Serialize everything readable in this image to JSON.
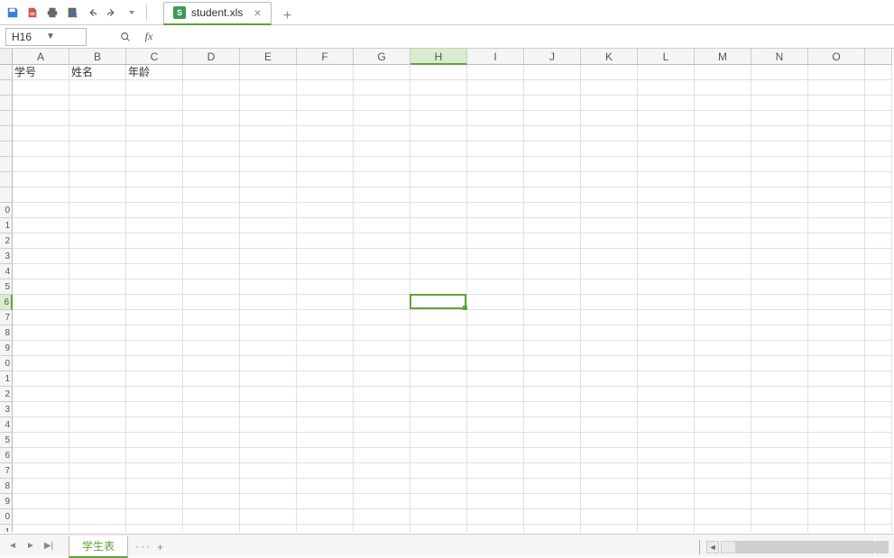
{
  "toolbar": {
    "icons": [
      "save-icon",
      "export-icon",
      "print-icon",
      "print-preview-icon",
      "undo-icon",
      "redo-icon"
    ]
  },
  "tabs": {
    "active": {
      "filename": "student.xls"
    }
  },
  "namebox": {
    "value": "H16"
  },
  "formula": {
    "fx_label": "fx",
    "value": ""
  },
  "columns": [
    "A",
    "B",
    "C",
    "D",
    "E",
    "F",
    "G",
    "H",
    "I",
    "J",
    "K",
    "L",
    "M",
    "N",
    "O"
  ],
  "active_col_index": 7,
  "row_count": 31,
  "visible_row_labels": [
    "",
    "",
    "",
    "",
    "",
    "",
    "",
    "",
    "",
    "0",
    "1",
    "2",
    "3",
    "4",
    "5",
    "6",
    "7",
    "8",
    "9",
    "0",
    "1",
    "2",
    "3",
    "4",
    "5",
    "6",
    "7",
    "8",
    "9",
    "0",
    "1"
  ],
  "active_row_index": 15,
  "data": {
    "A1": "学号",
    "B1": "姓名",
    "C1": "年龄"
  },
  "active_cell": {
    "col": 7,
    "row": 15
  },
  "sheets": {
    "active": "学生表",
    "menu_glyph": "···",
    "add_glyph": "+"
  }
}
